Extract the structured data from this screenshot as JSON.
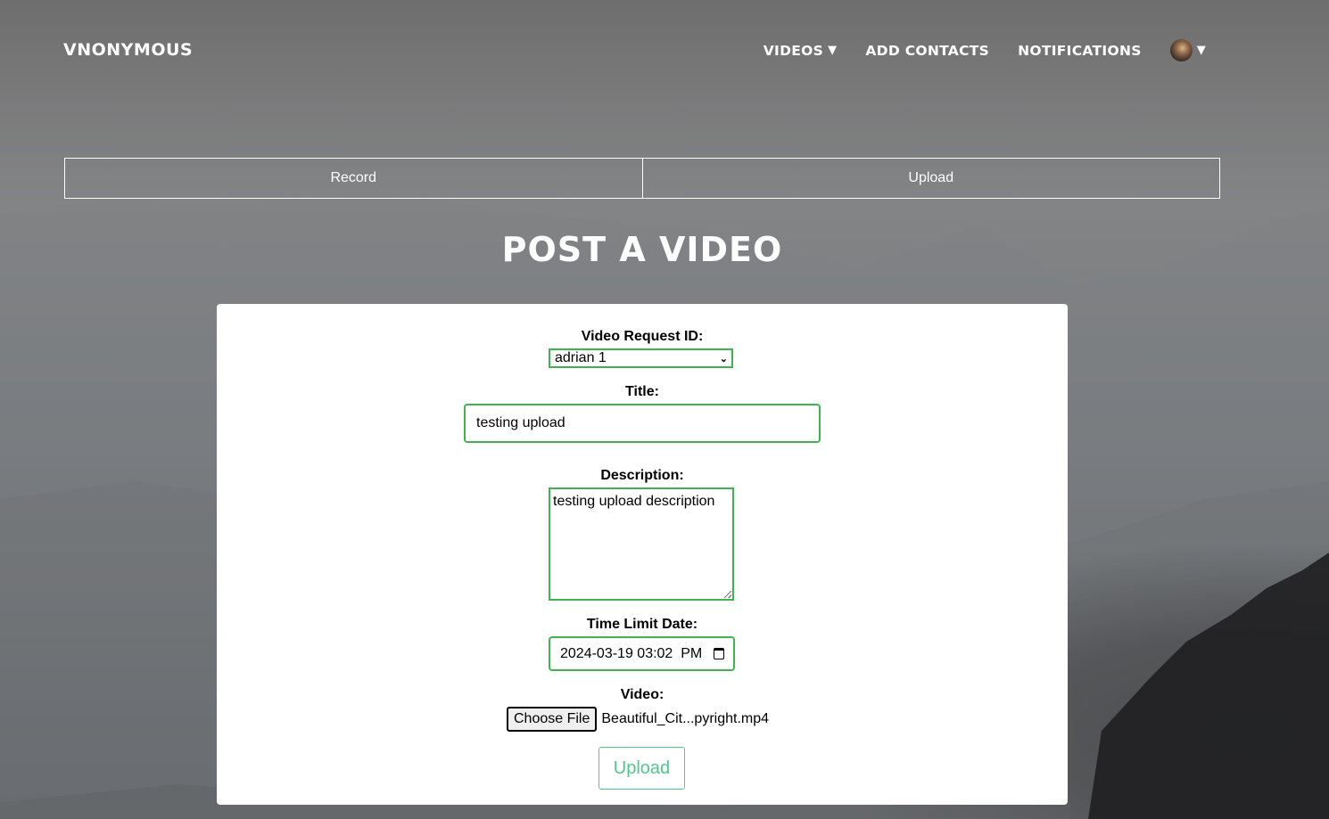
{
  "nav": {
    "brand": "VNONYMOUS",
    "videos_label": "VIDEOS",
    "add_contacts_label": "ADD CONTACTS",
    "notifications_label": "NOTIFICATIONS",
    "caret": "▼"
  },
  "tabs": {
    "record_label": "Record",
    "upload_label": "Upload"
  },
  "page": {
    "title": "POST A VIDEO"
  },
  "form": {
    "request_id_label": "Video Request ID:",
    "request_id_value": "adrian 1",
    "title_label": "Title:",
    "title_value": "testing upload",
    "description_label": "Description:",
    "description_value": "testing upload description",
    "time_limit_label": "Time Limit Date:",
    "time_limit_value": "2024-03-19 03:02  PM",
    "video_label": "Video:",
    "choose_file_label": "Choose File",
    "file_name": "Beautiful_Cit...pyright.mp4",
    "upload_button_label": "Upload"
  },
  "colors": {
    "accent_green": "#3fb34f",
    "upload_button_text": "#4fc98a"
  }
}
